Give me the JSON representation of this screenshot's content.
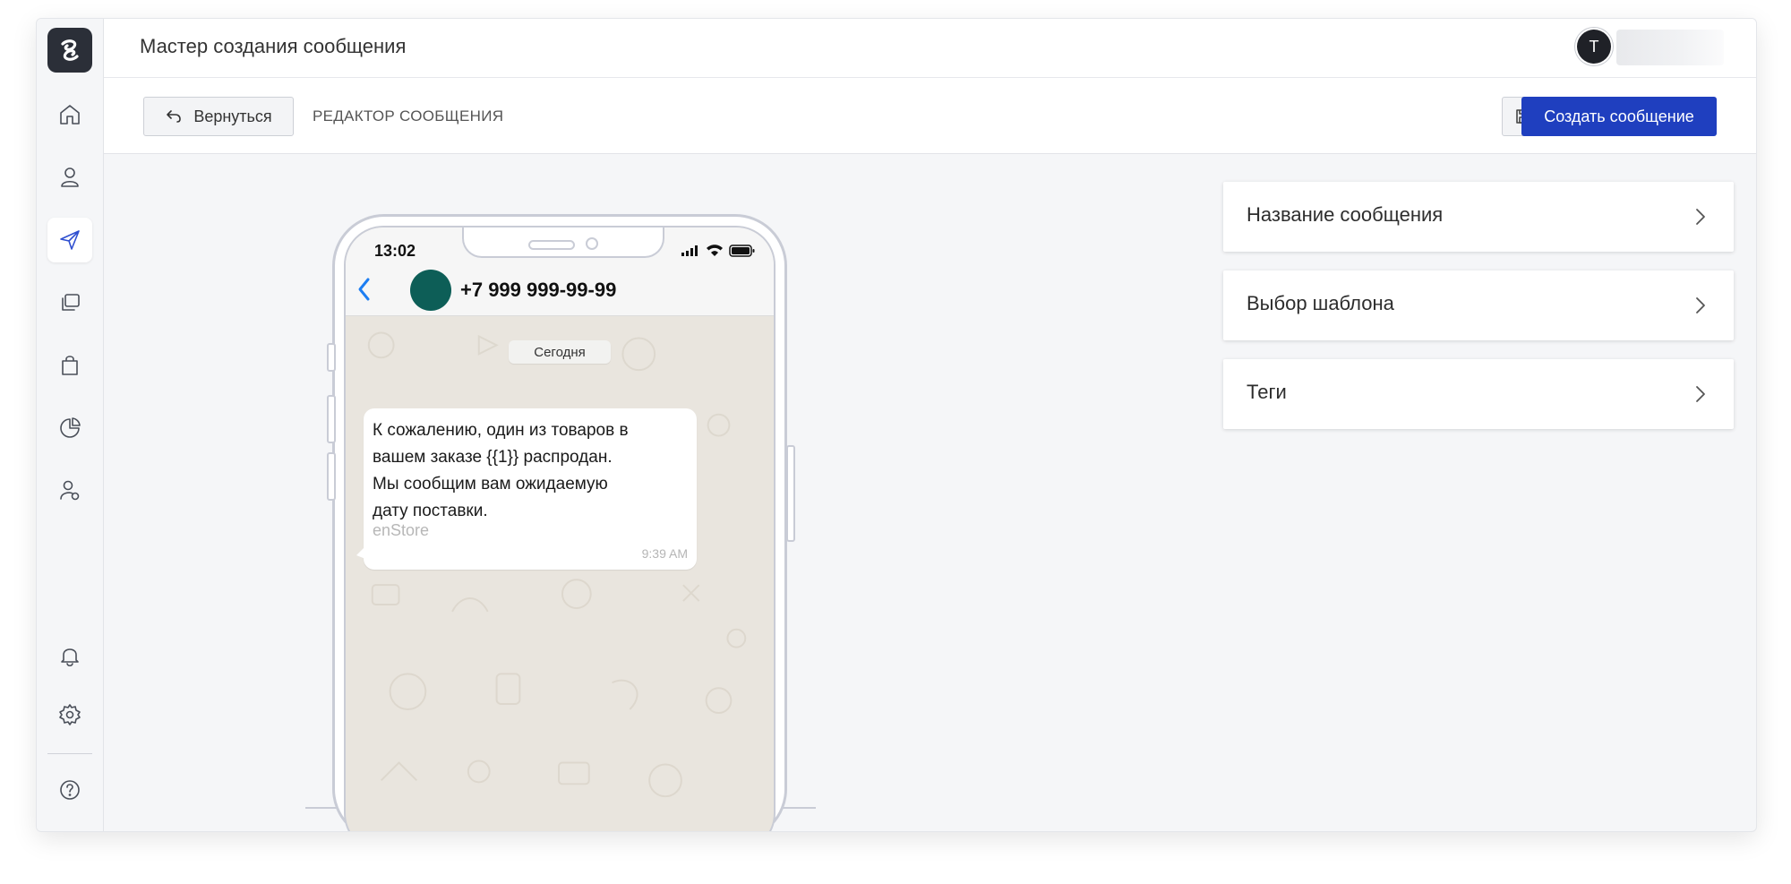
{
  "app": {
    "title": "Мастер создания сообщения"
  },
  "user": {
    "avatar_initial": "T"
  },
  "toolbar": {
    "back_label": "Вернуться",
    "breadcrumb": "РЕДАКТОР СООБЩЕНИЯ",
    "create_label": "Создать сообщение"
  },
  "sidebar": {
    "items": [
      {
        "icon": "home-icon"
      },
      {
        "icon": "user-icon"
      },
      {
        "icon": "send-icon",
        "active": true
      },
      {
        "icon": "copy-icon"
      },
      {
        "icon": "shopping-bag-icon"
      },
      {
        "icon": "pie-chart-icon"
      },
      {
        "icon": "user-settings-icon"
      },
      {
        "icon": "bell-icon"
      },
      {
        "icon": "gear-icon"
      },
      {
        "icon": "help-icon"
      }
    ]
  },
  "phone": {
    "time": "13:02",
    "contact": "+7 999 999-99-99",
    "date_chip": "Сегодня",
    "message": {
      "text": "К сожалению, один из товаров в\nвашем заказе {{1}} распродан.\nМы сообщим вам ожидаемую\nдату поставки.",
      "footer": "enStore",
      "time": "9:39 AM"
    }
  },
  "panels": [
    {
      "label": "Название сообщения"
    },
    {
      "label": "Выбор шаблона"
    },
    {
      "label": "Теги"
    }
  ],
  "colors": {
    "accent": "#1f3fbf",
    "active_icon": "#2f4fd0",
    "avatar_bg": "#0d5e57",
    "ios_blue": "#1d7ef2"
  }
}
